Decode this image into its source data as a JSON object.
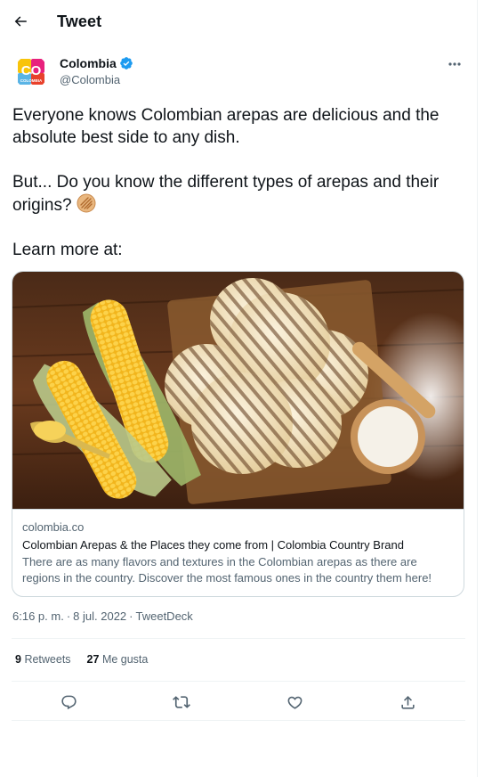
{
  "header": {
    "title": "Tweet",
    "back_icon": "arrow-left-icon"
  },
  "author": {
    "name": "Colombia",
    "handle": "@Colombia",
    "verified_icon": "verified-badge-icon",
    "avatar_text_top": "CO",
    "avatar_text_bottom": "COLOMBIA"
  },
  "tweet": {
    "line1": "Everyone knows Colombian arepas are delicious and the absolute best side to any dish.",
    "line2": "But... Do you know the different types of arepas and their origins? ",
    "line2_emoji": "arepa-emoji",
    "line3": "Learn more at:"
  },
  "card": {
    "domain": "colombia.co",
    "title": "Colombian Arepas & the Places they come from | Colombia Country Brand",
    "description": "There are as many flavors and textures in the Colombian arepas as there are regions in the country. Discover the most famous ones in the country them here!"
  },
  "meta": {
    "time": "6:16 p. m.",
    "separator1": "·",
    "date": "8 jul. 2022",
    "separator2": "·",
    "source": "TweetDeck"
  },
  "stats": {
    "retweets_count": "9",
    "retweets_label": "Retweets",
    "likes_count": "27",
    "likes_label": "Me gusta"
  },
  "actions": [
    "reply-icon",
    "retweet-icon",
    "like-icon",
    "share-icon"
  ],
  "colors": {
    "text": "#0f1419",
    "secondary": "#536471",
    "border": "#cfd9de",
    "verified": "#1d9bf0"
  }
}
